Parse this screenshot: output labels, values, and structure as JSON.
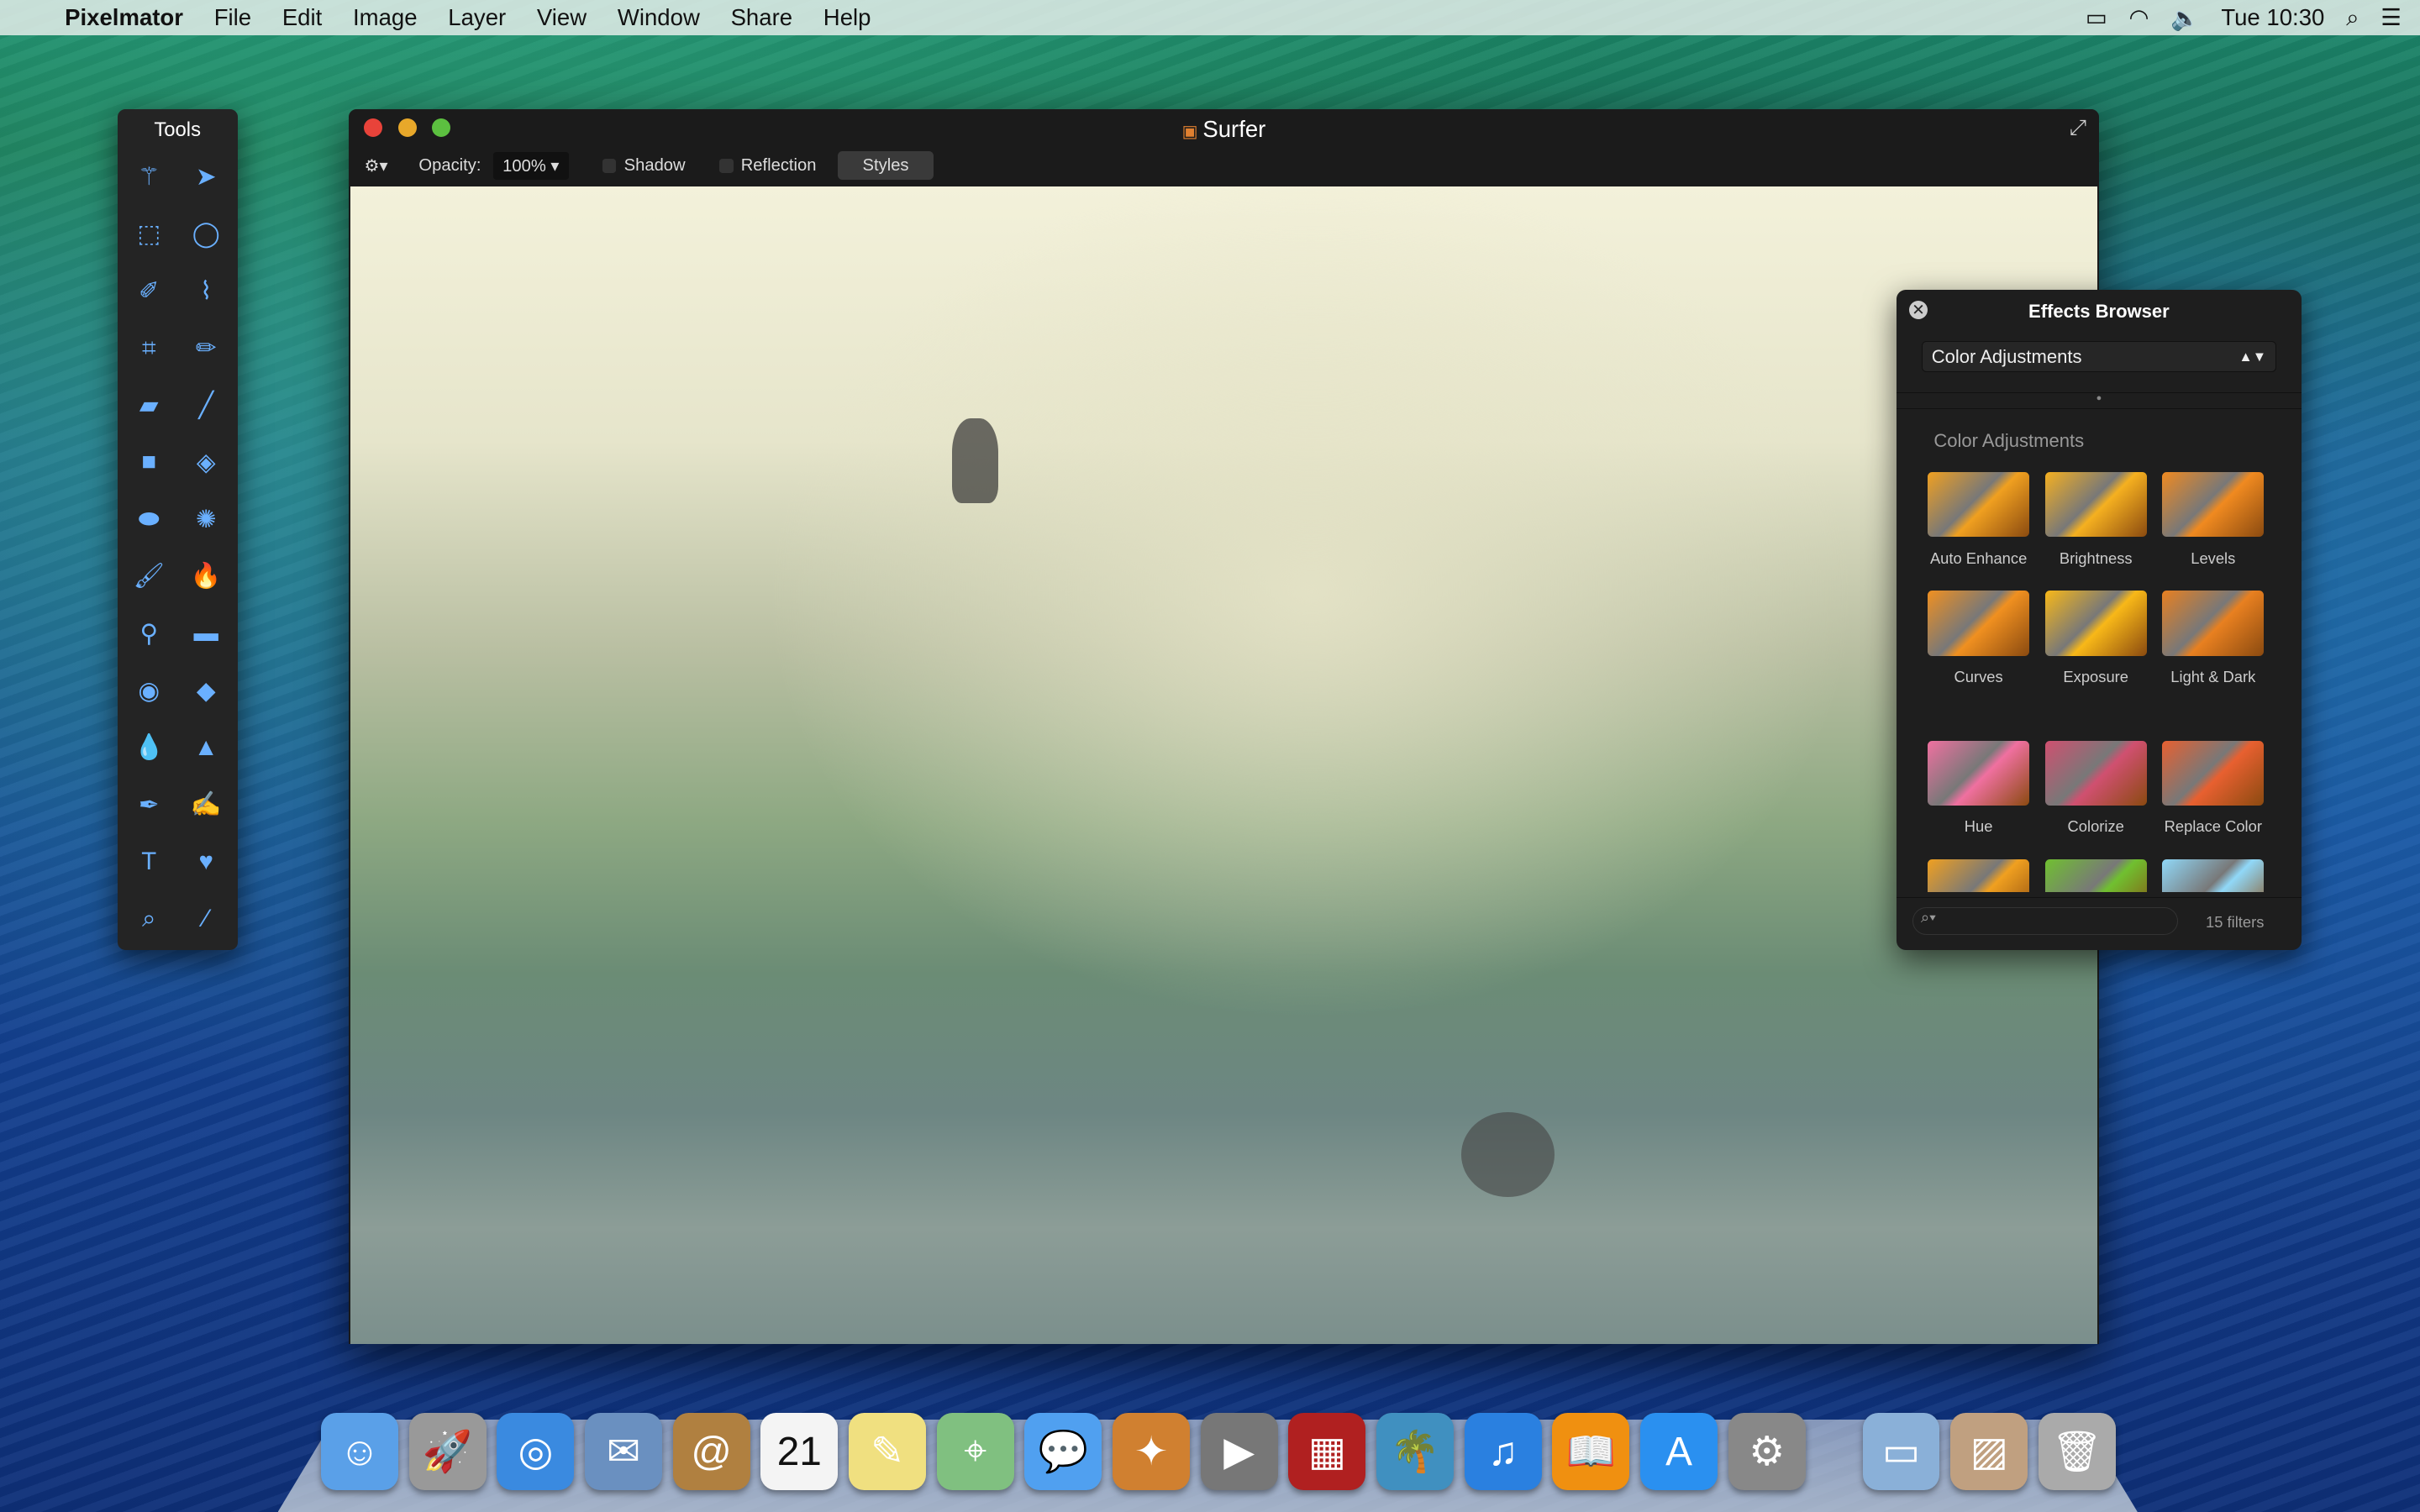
{
  "menubar": {
    "apple": "",
    "app": "Pixelmator",
    "items": [
      "File",
      "Edit",
      "Image",
      "Layer",
      "View",
      "Window",
      "Share",
      "Help"
    ],
    "clock": "Tue 10:30"
  },
  "tools": {
    "title": "Tools",
    "icons": [
      "magic-wand",
      "move-arrow",
      "rect-select",
      "ellipse-select",
      "magnetic-select",
      "lasso",
      "crop",
      "pencil",
      "eraser",
      "line",
      "rectangle",
      "paint-bucket",
      "ellipse",
      "color-picker",
      "brush",
      "burn",
      "stamp",
      "bandage",
      "red-eye",
      "sharpen",
      "blur",
      "cone",
      "pen",
      "freeform-pen",
      "type",
      "heart-shape",
      "zoom",
      "eyedropper"
    ]
  },
  "window": {
    "title": "Surfer",
    "toolbar": {
      "opacity_label": "Opacity:",
      "opacity_value": "100%",
      "shadow": "Shadow",
      "reflection": "Reflection",
      "styles": "Styles"
    }
  },
  "effects": {
    "title": "Effects Browser",
    "category": "Color Adjustments",
    "section": "Color Adjustments",
    "items": [
      {
        "label": "Auto Enhance",
        "color": "#f0a020"
      },
      {
        "label": "Brightness",
        "color": "#f5b020"
      },
      {
        "label": "Levels",
        "color": "#f08a20"
      },
      {
        "label": "Curves",
        "color": "#f09020"
      },
      {
        "label": "Exposure",
        "color": "#f8b818"
      },
      {
        "label": "Light & Dark",
        "color": "#e88020"
      },
      {
        "label": "Hue",
        "color": "#f070a0"
      },
      {
        "label": "Colorize",
        "color": "#d05070"
      },
      {
        "label": "Replace Color",
        "color": "#e86030"
      },
      {
        "label": "",
        "color": "#f0a020"
      },
      {
        "label": "",
        "color": "#70c030"
      },
      {
        "label": "",
        "color": "#90d8f8"
      }
    ],
    "search_placeholder": "",
    "count": "15 filters"
  },
  "dock": {
    "items": [
      {
        "name": "finder",
        "glyph": "☺",
        "color": "#5aa0e8"
      },
      {
        "name": "launchpad",
        "glyph": "🚀",
        "color": "#999"
      },
      {
        "name": "safari",
        "glyph": "◎",
        "color": "#3a8ae0"
      },
      {
        "name": "mail",
        "glyph": "✉",
        "color": "#6a90c0"
      },
      {
        "name": "contacts",
        "glyph": "@",
        "color": "#b08040"
      },
      {
        "name": "calendar",
        "glyph": "21",
        "color": "#f4f4f4"
      },
      {
        "name": "notes",
        "glyph": "✎",
        "color": "#f0e080"
      },
      {
        "name": "maps",
        "glyph": "⌖",
        "color": "#80c080"
      },
      {
        "name": "messages",
        "glyph": "💬",
        "color": "#50a0f0"
      },
      {
        "name": "pixelmator",
        "glyph": "✦",
        "color": "#d08030"
      },
      {
        "name": "facetime",
        "glyph": "▶",
        "color": "#777"
      },
      {
        "name": "photo-booth",
        "glyph": "▦",
        "color": "#b02020"
      },
      {
        "name": "iphoto",
        "glyph": "🌴",
        "color": "#4090c0"
      },
      {
        "name": "itunes",
        "glyph": "♫",
        "color": "#2a80e0"
      },
      {
        "name": "ibooks",
        "glyph": "📖",
        "color": "#f09010"
      },
      {
        "name": "app-store",
        "glyph": "A",
        "color": "#2a90f0"
      },
      {
        "name": "system-preferences",
        "glyph": "⚙",
        "color": "#888"
      },
      {
        "name": "documents-folder",
        "glyph": "▭",
        "color": "#8ab0d8"
      },
      {
        "name": "pictures-stack",
        "glyph": "▨",
        "color": "#c0a080"
      },
      {
        "name": "trash",
        "glyph": "🗑",
        "color": "#aaa"
      }
    ]
  }
}
